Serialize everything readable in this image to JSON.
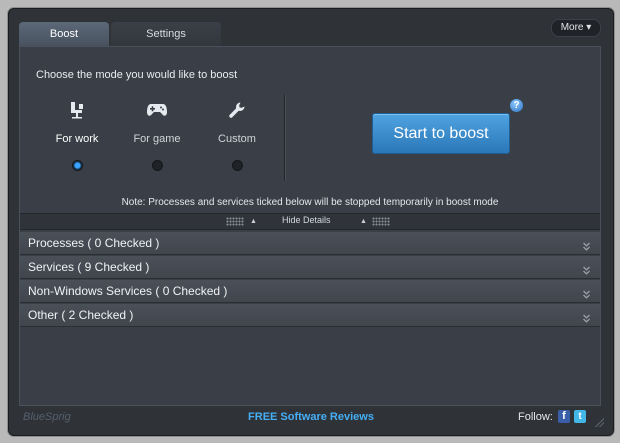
{
  "tabs": [
    {
      "label": "Boost",
      "active": true
    },
    {
      "label": "Settings",
      "active": false
    }
  ],
  "more_button": {
    "label": "More",
    "icon": "caret-down-icon"
  },
  "boost": {
    "choose_text": "Choose the mode you would like to boost",
    "modes": [
      {
        "label": "For work",
        "icon": "office-chair-icon",
        "selected": true
      },
      {
        "label": "For game",
        "icon": "gamepad-icon",
        "selected": false
      },
      {
        "label": "Custom",
        "icon": "wrench-icon",
        "selected": false
      }
    ],
    "start_button": "Start to boost",
    "help_icon": "?",
    "note": "Note: Processes and services ticked below will be stopped temporarily in boost mode"
  },
  "details_bar": {
    "hide_label": "Hide Details"
  },
  "sections": [
    {
      "label": "Processes ( 0 Checked )"
    },
    {
      "label": "Services ( 9 Checked )"
    },
    {
      "label": "Non-Windows Services ( 0 Checked )"
    },
    {
      "label": "Other ( 2 Checked )"
    }
  ],
  "footer": {
    "logo": "BlueSprig",
    "link": "FREE Software Reviews",
    "follow": "Follow:",
    "facebook": "f",
    "twitter": "t"
  },
  "colors": {
    "accent": "#2b77b8",
    "link": "#45aef5",
    "background": "#2f3237"
  }
}
